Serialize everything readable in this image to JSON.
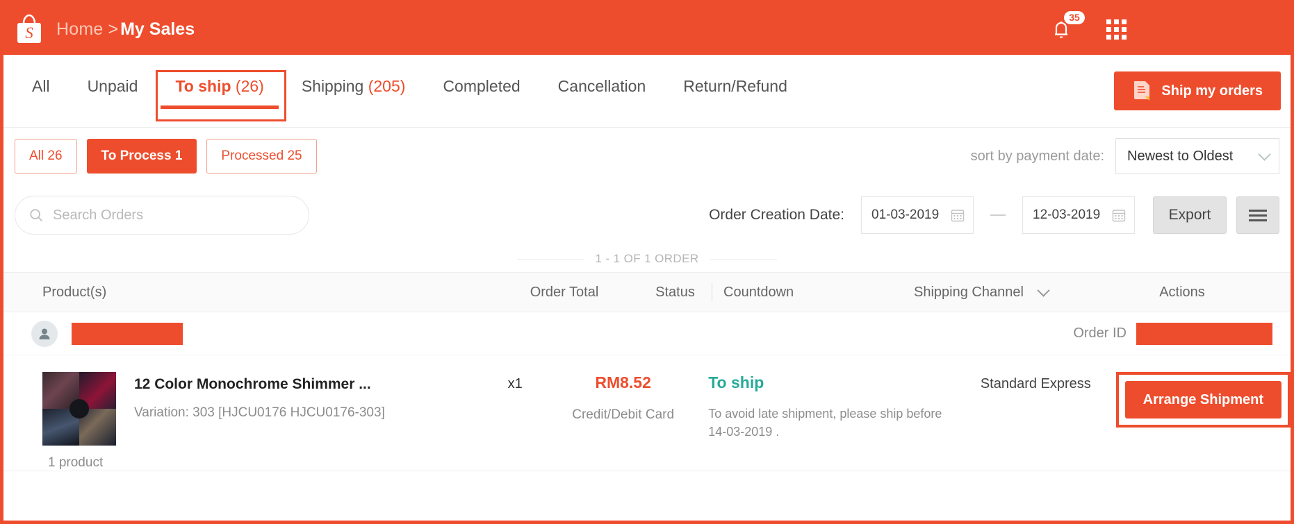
{
  "brand": {
    "accent": "#ee4d2d",
    "logo_letter": "S",
    "logo_name": "shopee-bag-logo"
  },
  "topbar": {
    "breadcrumb": {
      "home": "Home",
      "separator": ">",
      "current": "My Sales"
    },
    "notifications": {
      "count": "35",
      "icon": "bell-icon"
    },
    "apps_icon": "grid-apps-icon"
  },
  "tabs": {
    "items": [
      {
        "label": "All",
        "count": "",
        "active": false
      },
      {
        "label": "Unpaid",
        "count": "",
        "active": false
      },
      {
        "label": "To ship",
        "count": "(26)",
        "active": true
      },
      {
        "label": "Shipping",
        "count": "(205)",
        "active": false
      },
      {
        "label": "Completed",
        "count": "",
        "active": false
      },
      {
        "label": "Cancellation",
        "count": "",
        "active": false
      },
      {
        "label": "Return/Refund",
        "count": "",
        "active": false
      }
    ],
    "ship_my_orders": "Ship my orders"
  },
  "filters": {
    "chips": [
      {
        "label": "All 26",
        "style": "outline"
      },
      {
        "label": "To Process 1",
        "style": "solid"
      },
      {
        "label": "Processed 25",
        "style": "outline"
      }
    ],
    "sort_label": "sort by payment date:",
    "sort_value": "Newest to Oldest"
  },
  "search": {
    "placeholder": "Search Orders",
    "value": "",
    "date_label": "Order Creation Date:",
    "date_from": "01-03-2019",
    "date_to": "12-03-2019",
    "export_label": "Export"
  },
  "list": {
    "count_text": "1 - 1 OF 1 ORDER",
    "columns": {
      "product": "Product(s)",
      "order_total": "Order Total",
      "status": "Status",
      "countdown": "Countdown",
      "shipping_channel": "Shipping Channel",
      "actions": "Actions"
    }
  },
  "order": {
    "buyer_name_redacted": true,
    "order_id_label": "Order ID",
    "order_id_redacted": true,
    "product": {
      "name": "12 Color Monochrome Shimmer ...",
      "variation": "Variation: 303 [HJCU0176 HJCU0176-303]",
      "product_count": "1 product",
      "quantity": "x1"
    },
    "total": {
      "price": "RM8.52",
      "payment_method": "Credit/Debit Card"
    },
    "status": {
      "label": "To ship",
      "color": "#26aa99",
      "note": "To avoid late shipment, please ship before 14-03-2019 ."
    },
    "shipping_channel": "Standard Express",
    "action_label": "Arrange Shipment"
  }
}
